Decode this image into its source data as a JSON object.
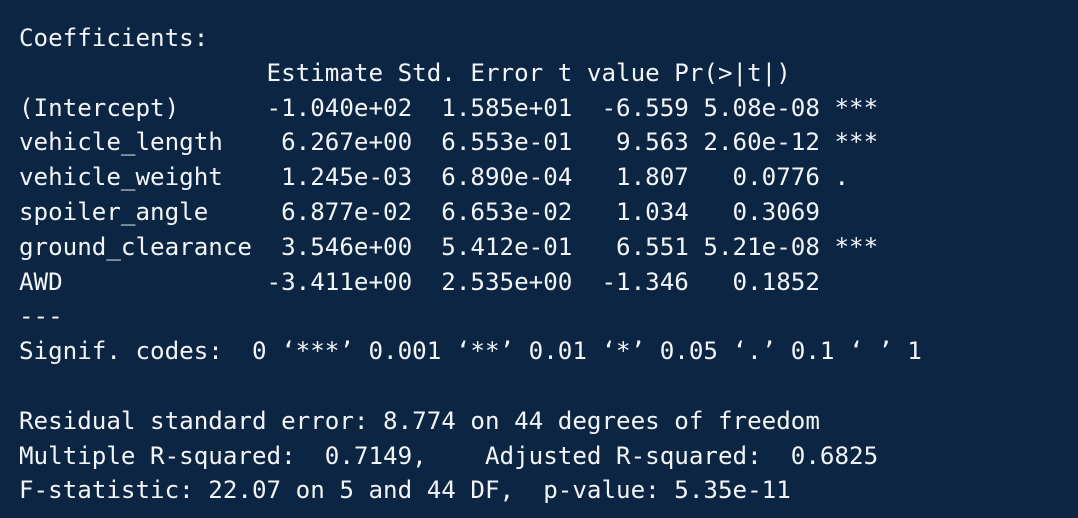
{
  "output": {
    "coefficients_heading": "Coefficients:",
    "table_header": "                 Estimate Std. Error t value Pr(>|t|)",
    "rows": [
      "(Intercept)      -1.040e+02  1.585e+01  -6.559 5.08e-08 ***",
      "vehicle_length    6.267e+00  6.553e-01   9.563 2.60e-12 ***",
      "vehicle_weight    1.245e-03  6.890e-04   1.807   0.0776 .",
      "spoiler_angle     6.877e-02  6.653e-02   1.034   0.3069",
      "ground_clearance  3.546e+00  5.412e-01   6.551 5.21e-08 ***",
      "AWD              -3.411e+00  2.535e+00  -1.346   0.1852"
    ],
    "separator": "---",
    "signif_codes": "Signif. codes:  0 ‘***’ 0.001 ‘**’ 0.01 ‘*’ 0.05 ‘.’ 0.1 ‘ ’ 1",
    "residual_se": "Residual standard error: 8.774 on 44 degrees of freedom",
    "r_squared": "Multiple R-squared:  0.7149,\tAdjusted R-squared:  0.6825",
    "f_statistic": "F-statistic: 22.07 on 5 and 44 DF,  p-value: 5.35e-11"
  },
  "colors": {
    "background": "#0c2542",
    "text": "#f2f5f8"
  }
}
